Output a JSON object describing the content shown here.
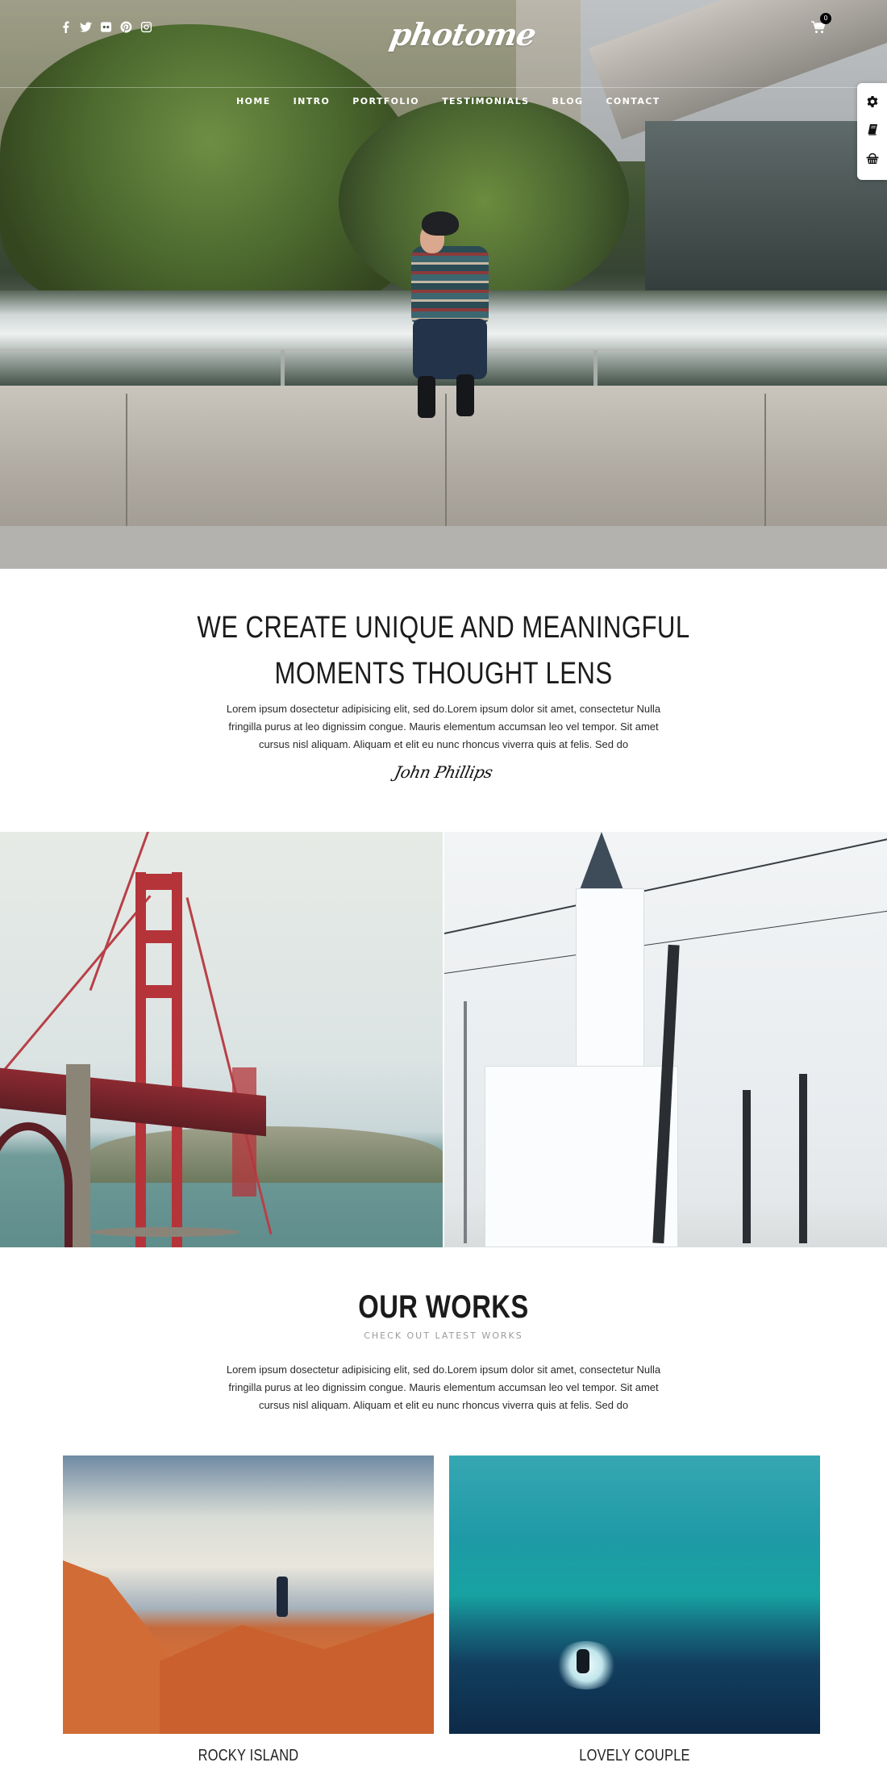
{
  "header": {
    "logo_text": "photome",
    "social_icons": [
      {
        "name": "facebook-icon",
        "label": "Facebook"
      },
      {
        "name": "twitter-icon",
        "label": "Twitter"
      },
      {
        "name": "flickr-icon",
        "label": "Flickr"
      },
      {
        "name": "pinterest-icon",
        "label": "Pinterest"
      },
      {
        "name": "instagram-icon",
        "label": "Instagram"
      }
    ],
    "cart_count": "0",
    "nav": [
      {
        "label": "HOME"
      },
      {
        "label": "INTRO"
      },
      {
        "label": "PORTFOLIO"
      },
      {
        "label": "TESTIMONIALS"
      },
      {
        "label": "BLOG"
      },
      {
        "label": "CONTACT"
      }
    ]
  },
  "side_panel": {
    "items": [
      {
        "icon": "gear-icon",
        "label": "Settings"
      },
      {
        "icon": "book-icon",
        "label": "Documentation"
      },
      {
        "icon": "basket-icon",
        "label": "Purchase"
      }
    ]
  },
  "intro": {
    "headline_line1": "WE CREATE UNIQUE AND MEANINGFUL",
    "headline_line2": "MOMENTS THOUGHT LENS",
    "paragraph_lines": [
      "Lorem ipsum dosectetur adipisicing elit, sed do.Lorem ipsum dolor sit amet, consectetur Nulla",
      "fringilla purus at leo dignissim congue. Mauris elementum accumsan leo vel tempor. Sit amet",
      "cursus nisl aliquam. Aliquam et elit eu nunc rhoncus viverra quis at felis. Sed do"
    ],
    "signature": "John Phillips"
  },
  "gallery_pair": [
    {
      "subject": "Golden Gate Bridge"
    },
    {
      "subject": "White church with bare trees in snow"
    }
  ],
  "works": {
    "title": "OUR WORKS",
    "subtitle": "CHECK OUT LATEST WORKS",
    "paragraph_lines": [
      "Lorem ipsum dosectetur adipisicing elit, sed do.Lorem ipsum dolor sit amet, consectetur Nulla",
      "fringilla purus at leo dignissim congue. Mauris elementum accumsan leo vel tempor. Sit amet",
      "cursus nisl aliquam. Aliquam et elit eu nunc rhoncus viverra quis at felis. Sed do"
    ],
    "items": [
      {
        "caption": "ROCKY ISLAND"
      },
      {
        "caption": "LOVELY COUPLE"
      }
    ]
  }
}
